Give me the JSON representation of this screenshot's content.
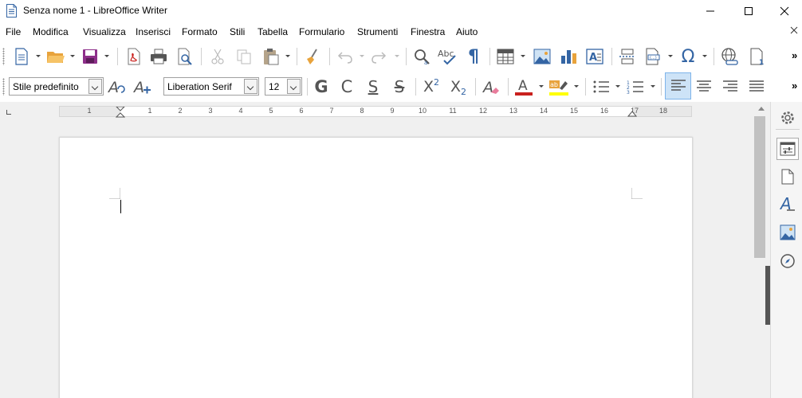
{
  "window": {
    "title": "Senza nome 1 - LibreOffice Writer"
  },
  "menu": {
    "items": [
      "File",
      "Modifica",
      "Visualizza",
      "Inserisci",
      "Formato",
      "Stili",
      "Tabella",
      "Formulario",
      "Strumenti",
      "Finestra",
      "Aiuto"
    ]
  },
  "toolbar_standard": {
    "icons": [
      "new-document-icon",
      "open-folder-icon",
      "save-icon",
      "export-pdf-icon",
      "print-icon",
      "print-preview-icon",
      "cut-icon",
      "copy-icon",
      "paste-icon",
      "clone-formatting-icon",
      "undo-icon",
      "redo-icon",
      "find-replace-icon",
      "spelling-icon",
      "formatting-marks-icon",
      "insert-table-icon",
      "insert-image-icon",
      "insert-chart-icon",
      "insert-textbox-icon",
      "page-break-icon",
      "insert-field-icon",
      "special-character-icon",
      "hyperlink-icon",
      "footnote-icon"
    ],
    "special_char_glyph": "Ω",
    "spelling_glyph": "Abc",
    "formatting_marks_glyph": "¶",
    "overflow_glyph": "»"
  },
  "toolbar_formatting": {
    "paragraph_style": "Stile predefinito",
    "font_name": "Liberation Serif",
    "font_size": "12",
    "bold_glyph": "G",
    "italic_glyph": "C",
    "underline_glyph": "S",
    "strike_glyph": "S",
    "superscript_glyph": "X",
    "superscript_exp": "2",
    "subscript_glyph": "X",
    "subscript_exp": "2",
    "clear_glyph": "A",
    "font_color_glyph": "A",
    "highlight_glyph": "ab",
    "overflow_glyph": "»",
    "colors": {
      "font_color": "#c9211e",
      "highlight_color": "#ffff00",
      "accent": "#3465a4",
      "active_bg": "#cde3f7"
    }
  },
  "ruler": {
    "numbers": [
      "1",
      "1",
      "2",
      "3",
      "4",
      "5",
      "6",
      "7",
      "8",
      "9",
      "10",
      "11",
      "12",
      "13",
      "14",
      "15",
      "16",
      "17",
      "18"
    ]
  },
  "sidebar": {
    "icons": [
      "properties-gear-icon",
      "sidebar-properties-icon",
      "page-icon",
      "styles-icon",
      "gallery-icon",
      "navigator-icon"
    ]
  }
}
